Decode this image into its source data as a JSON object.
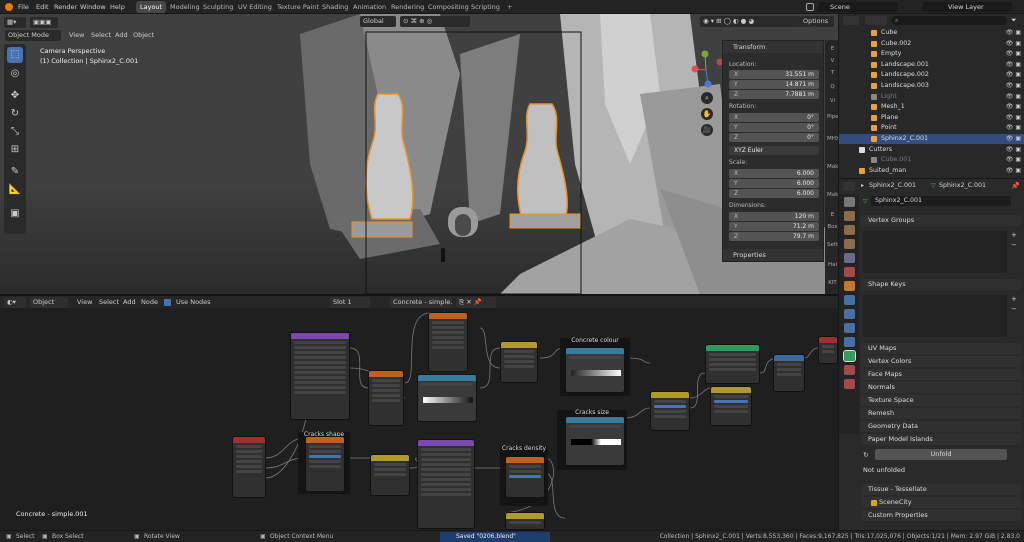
{
  "topbar": {
    "menu": [
      "File",
      "Edit",
      "Render",
      "Window",
      "Help"
    ],
    "workspaces": [
      "Layout",
      "Modeling",
      "Sculpting",
      "UV Editing",
      "Texture Paint",
      "Shading",
      "Animation",
      "Rendering",
      "Compositing",
      "Scripting"
    ],
    "active_workspace": "Layout",
    "scene": "Scene",
    "view_layer": "View Layer"
  },
  "viewport": {
    "mode": "Object Mode",
    "menu": [
      "View",
      "Select",
      "Add",
      "Object"
    ],
    "orientation": "Global",
    "options": "Options",
    "info_line1": "Camera Perspective",
    "info_line2": "(1) Collection | Sphinx2_C.001"
  },
  "npanel": {
    "title": "Transform",
    "location_label": "Location:",
    "location": [
      {
        "axis": "X",
        "value": "31.551 m"
      },
      {
        "axis": "Y",
        "value": "14.871 m"
      },
      {
        "axis": "Z",
        "value": "7.7881 m"
      }
    ],
    "rotation_label": "Rotation:",
    "rotation": [
      {
        "axis": "X",
        "value": "0°"
      },
      {
        "axis": "Y",
        "value": "0°"
      },
      {
        "axis": "Z",
        "value": "0°"
      }
    ],
    "rotation_mode": "XYZ Euler",
    "scale_label": "Scale:",
    "scale": [
      {
        "axis": "X",
        "value": "6.000"
      },
      {
        "axis": "Y",
        "value": "6.000"
      },
      {
        "axis": "Z",
        "value": "6.000"
      }
    ],
    "dimensions_label": "Dimensions:",
    "dimensions": [
      {
        "axis": "X",
        "value": "120 m"
      },
      {
        "axis": "Y",
        "value": "71.2 m"
      },
      {
        "axis": "Z",
        "value": "79.7 m"
      }
    ],
    "properties": "Properties",
    "tabs": [
      "E",
      "V",
      "T",
      "Q",
      "Vi",
      "Pipe",
      "MHX2",
      "Make",
      "MakeT",
      "E",
      "Box",
      "Sett",
      "Hai",
      "KIT"
    ]
  },
  "nodeeditor": {
    "type": "Object",
    "menu": [
      "View",
      "Select",
      "Add",
      "Node"
    ],
    "use_nodes": "Use Nodes",
    "slot": "Slot 1",
    "material": "Concrete - simple.0...",
    "material_label": "Concrete - simple.001",
    "frames": [
      "Concrete colour",
      "Cracks size",
      "Cracks shape",
      "Cracks density"
    ]
  },
  "outliner": {
    "search_placeholder": "",
    "items": [
      {
        "name": "Cube",
        "icon": "#e8a040",
        "dim": false,
        "sel": false
      },
      {
        "name": "Cube.002",
        "icon": "#e8a040",
        "dim": false,
        "sel": false
      },
      {
        "name": "Empty",
        "icon": "#e8a040",
        "dim": false,
        "sel": false
      },
      {
        "name": "Landscape.001",
        "icon": "#e8a040",
        "dim": false,
        "sel": false
      },
      {
        "name": "Landscape.002",
        "icon": "#e8a040",
        "dim": false,
        "sel": false
      },
      {
        "name": "Landscape.003",
        "icon": "#e8a040",
        "dim": false,
        "sel": false
      },
      {
        "name": "Light",
        "icon": "#888888",
        "dim": true,
        "sel": false
      },
      {
        "name": "Mesh_1",
        "icon": "#e8a040",
        "dim": false,
        "sel": false
      },
      {
        "name": "Plane",
        "icon": "#e8a040",
        "dim": false,
        "sel": false
      },
      {
        "name": "Point",
        "icon": "#e8a040",
        "dim": false,
        "sel": false
      },
      {
        "name": "Sphinx2_C.001",
        "icon": "#e8a040",
        "dim": false,
        "sel": true
      },
      {
        "name": "Cutters",
        "icon": "#dddddd",
        "dim": false,
        "sel": false
      },
      {
        "name": "Cube.001",
        "icon": "#888888",
        "dim": true,
        "sel": false
      },
      {
        "name": "Suited_man",
        "icon": "#e8a040",
        "dim": false,
        "sel": false
      }
    ]
  },
  "props": {
    "object": "Sphinx2_C.001",
    "mesh": "Sphinx2_C.001",
    "data_field": "Sphinx2_C.001",
    "sections": [
      "Vertex Groups",
      "Shape Keys",
      "UV Maps",
      "Vertex Colors",
      "Face Maps",
      "Normals",
      "Texture Space",
      "Remesh",
      "Geometry Data",
      "Paper Model Islands"
    ],
    "unfold": "Unfold",
    "not_unfolded": "Not unfolded",
    "sections2": [
      "Tissue - Tessellate",
      "SceneCity",
      "Custom Properties"
    ]
  },
  "status": {
    "select": "Select",
    "box_select": "Box Select",
    "rotate_view": "Rotate View",
    "context_menu": "Object Context Menu",
    "saved": "Saved \"0206.blend\"",
    "stats": "Collection | Sphinx2_C.001 | Verts:8,553,360 | Faces:9,167,825 | Tris:17,025,076 | Objects:1/21 | Mem: 2.97 GiB | 2.83.0"
  },
  "colors": {
    "accent": "#334d80",
    "header": "#232323",
    "panel": "#2c2c2c",
    "viewport": "#3d3d3d",
    "node_bg": "#1f1f1f",
    "select_orange": "#e8932d",
    "saved_bar": "#1f3d6e"
  }
}
